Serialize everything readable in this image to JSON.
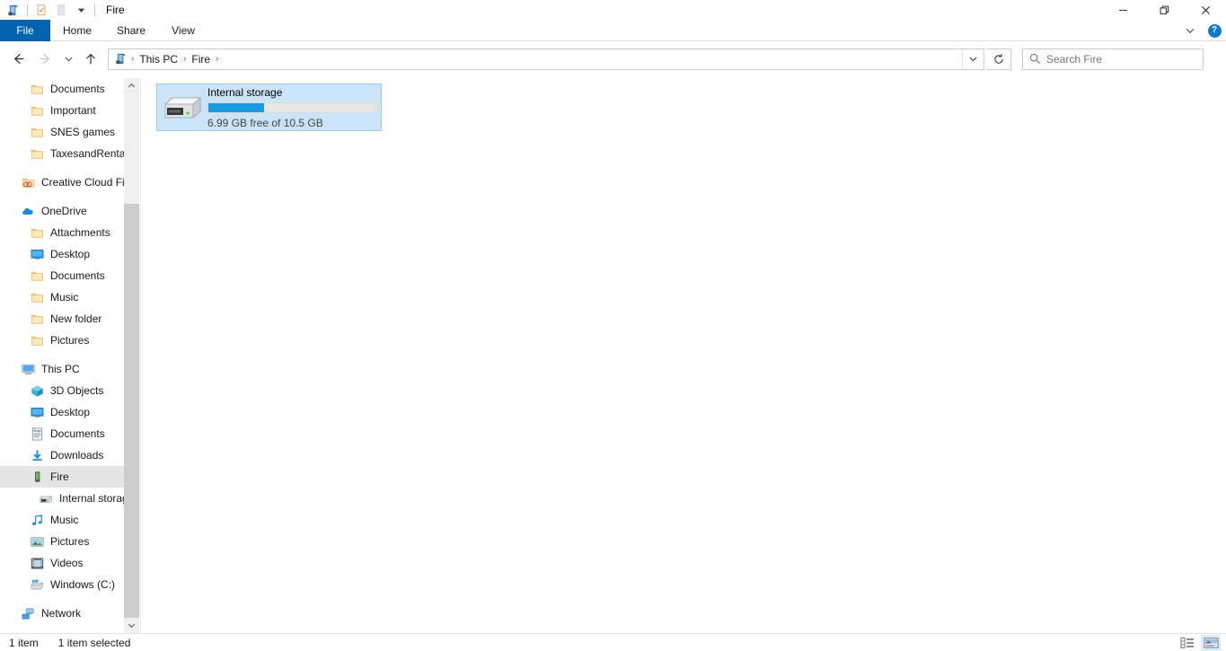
{
  "window": {
    "title": "Fire",
    "quick_access": [
      {
        "name": "device-icon",
        "label": "Fire device"
      },
      {
        "name": "properties-icon",
        "label": "Properties"
      },
      {
        "name": "new-folder-icon",
        "label": "New folder"
      },
      {
        "name": "customize-qat-chevron-icon",
        "label": "Customize Quick Access Toolbar"
      }
    ],
    "controls": {
      "minimize": "—",
      "maximize": "❐",
      "close": "✕"
    }
  },
  "ribbon": {
    "tabs": [
      {
        "label": "File",
        "active": true
      },
      {
        "label": "Home",
        "active": false
      },
      {
        "label": "Share",
        "active": false
      },
      {
        "label": "View",
        "active": false
      }
    ],
    "collapse_icon": "chevron-down-icon",
    "help_label": "?"
  },
  "navbar": {
    "back_label": "Back",
    "forward_label": "Forward",
    "recent_label": "Recent locations",
    "up_label": "Up",
    "breadcrumbs": [
      {
        "label": "This PC"
      },
      {
        "label": "Fire"
      }
    ],
    "separator": "›",
    "dropdown_icon": "chevron-down-icon",
    "refresh_icon": "refresh-icon",
    "refresh_label": "Refresh"
  },
  "search": {
    "placeholder": "Search Fire",
    "value": "",
    "icon": "search-icon"
  },
  "sidebar": {
    "items": [
      {
        "label": "Documents",
        "icon": "folder-icon",
        "level": 1,
        "selected": false,
        "gap_before": false
      },
      {
        "label": "Important",
        "icon": "folder-icon",
        "level": 1,
        "selected": false,
        "gap_before": false
      },
      {
        "label": "SNES games",
        "icon": "folder-icon",
        "level": 1,
        "selected": false,
        "gap_before": false
      },
      {
        "label": "TaxesandRental",
        "icon": "folder-icon",
        "level": 1,
        "selected": false,
        "gap_before": false
      },
      {
        "label": "Creative Cloud Fil",
        "icon": "creative-cloud-icon",
        "level": 0,
        "selected": false,
        "gap_before": true
      },
      {
        "label": "OneDrive",
        "icon": "onedrive-icon",
        "level": 0,
        "selected": false,
        "gap_before": true
      },
      {
        "label": "Attachments",
        "icon": "folder-icon",
        "level": 1,
        "selected": false,
        "gap_before": false
      },
      {
        "label": "Desktop",
        "icon": "desktop-icon",
        "level": 1,
        "selected": false,
        "gap_before": false
      },
      {
        "label": "Documents",
        "icon": "folder-icon",
        "level": 1,
        "selected": false,
        "gap_before": false
      },
      {
        "label": "Music",
        "icon": "folder-icon",
        "level": 1,
        "selected": false,
        "gap_before": false
      },
      {
        "label": "New folder",
        "icon": "folder-icon",
        "level": 1,
        "selected": false,
        "gap_before": false
      },
      {
        "label": "Pictures",
        "icon": "folder-icon",
        "level": 1,
        "selected": false,
        "gap_before": false
      },
      {
        "label": "This PC",
        "icon": "this-pc-icon",
        "level": 0,
        "selected": false,
        "gap_before": true
      },
      {
        "label": "3D Objects",
        "icon": "3d-objects-icon",
        "level": 1,
        "selected": false,
        "gap_before": false
      },
      {
        "label": "Desktop",
        "icon": "desktop-icon",
        "level": 1,
        "selected": false,
        "gap_before": false
      },
      {
        "label": "Documents",
        "icon": "documents-icon",
        "level": 1,
        "selected": false,
        "gap_before": false
      },
      {
        "label": "Downloads",
        "icon": "downloads-icon",
        "level": 1,
        "selected": false,
        "gap_before": false
      },
      {
        "label": "Fire",
        "icon": "device-icon",
        "level": 1,
        "selected": true,
        "gap_before": false
      },
      {
        "label": "Internal storage",
        "icon": "drive-icon",
        "level": 2,
        "selected": false,
        "gap_before": false
      },
      {
        "label": "Music",
        "icon": "music-icon",
        "level": 1,
        "selected": false,
        "gap_before": false
      },
      {
        "label": "Pictures",
        "icon": "pictures-icon",
        "level": 1,
        "selected": false,
        "gap_before": false
      },
      {
        "label": "Videos",
        "icon": "videos-icon",
        "level": 1,
        "selected": false,
        "gap_before": false
      },
      {
        "label": "Windows (C:)",
        "icon": "windows-drive-icon",
        "level": 1,
        "selected": false,
        "gap_before": false
      },
      {
        "label": "Network",
        "icon": "network-icon",
        "level": 0,
        "selected": false,
        "gap_before": true
      }
    ],
    "scroll_up_icon": "chevron-up-icon",
    "scroll_down_icon": "chevron-down-icon"
  },
  "content": {
    "items": [
      {
        "title": "Internal storage",
        "subtitle": "6.99 GB free of 10.5 GB",
        "icon": "drive-icon",
        "selected": true,
        "usage_percent": 33,
        "free_gb": 6.99,
        "total_gb": 10.5
      }
    ]
  },
  "statusbar": {
    "item_count": "1 item",
    "selection": "1 item selected",
    "views": [
      {
        "name": "details-view-button",
        "label": "Details view",
        "active": false
      },
      {
        "name": "large-icons-view-button",
        "label": "Large icons view",
        "active": true
      }
    ]
  },
  "colors": {
    "accent": "#0063b1",
    "selection_fill": "#cce4f7",
    "selection_border": "#99cbf0",
    "progress_blue": "#1a9ae0",
    "sidebar_selected": "#e5e5e5"
  }
}
